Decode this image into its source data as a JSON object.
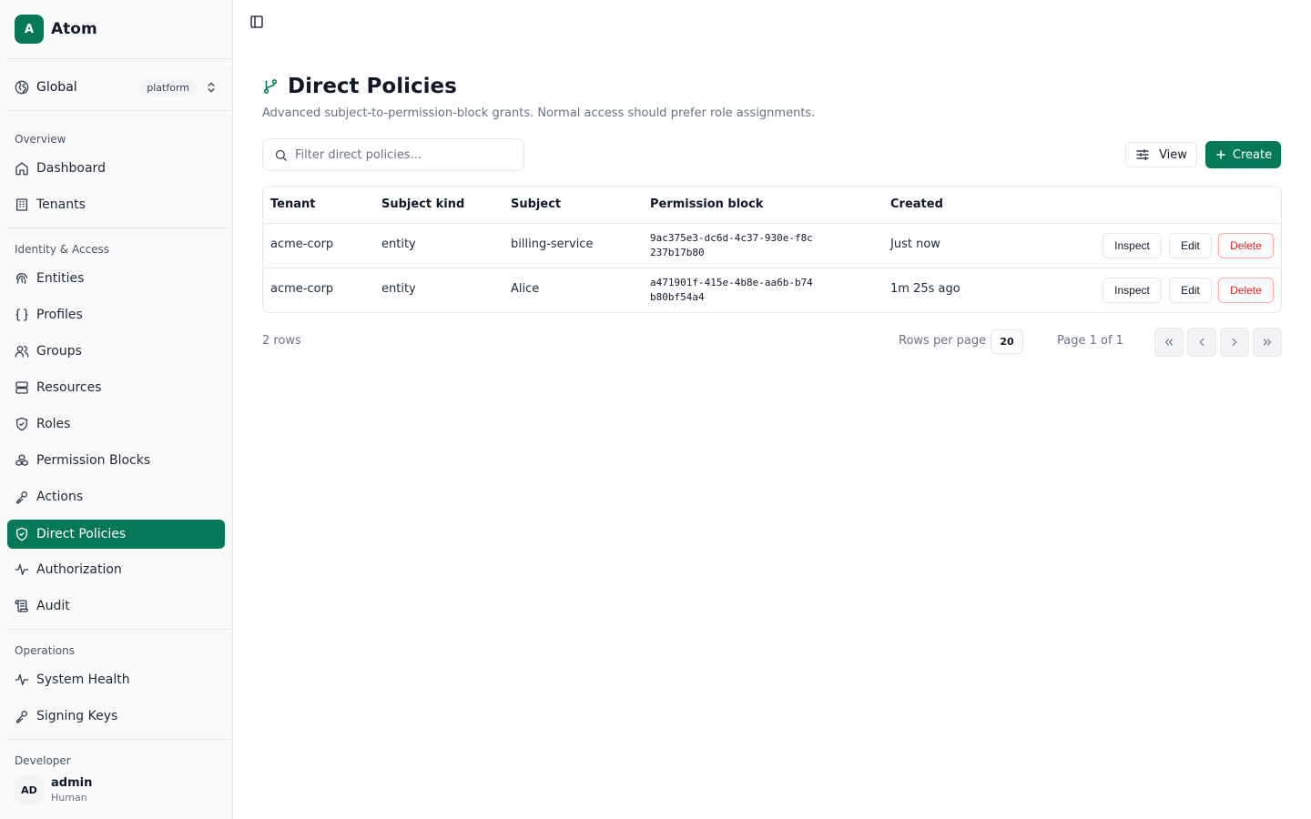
{
  "app": {
    "logo_letter": "A",
    "name": "Atom"
  },
  "scope": {
    "label": "Global",
    "badge": "platform"
  },
  "sidebar": {
    "groups": [
      {
        "label": "Overview",
        "items": [
          {
            "label": "Dashboard",
            "icon": "home-icon"
          },
          {
            "label": "Tenants",
            "icon": "building-icon"
          }
        ]
      },
      {
        "label": "Identity & Access",
        "items": [
          {
            "label": "Entities",
            "icon": "fingerprint-icon"
          },
          {
            "label": "Profiles",
            "icon": "braces-icon"
          },
          {
            "label": "Groups",
            "icon": "users-icon"
          },
          {
            "label": "Resources",
            "icon": "server-icon"
          },
          {
            "label": "Roles",
            "icon": "shield-check-icon"
          },
          {
            "label": "Permission Blocks",
            "icon": "boxes-icon"
          },
          {
            "label": "Actions",
            "icon": "key-icon"
          },
          {
            "label": "Direct Policies",
            "icon": "shield-check-icon",
            "active": true
          },
          {
            "label": "Authorization",
            "icon": "activity-icon"
          },
          {
            "label": "Audit",
            "icon": "scroll-icon"
          }
        ]
      },
      {
        "label": "Operations",
        "items": [
          {
            "label": "System Health",
            "icon": "activity-icon"
          },
          {
            "label": "Signing Keys",
            "icon": "key-icon"
          }
        ]
      },
      {
        "label": "Developer",
        "items": []
      }
    ]
  },
  "user": {
    "initials": "AD",
    "name": "admin",
    "kind": "Human"
  },
  "page": {
    "title": "Direct Policies",
    "description": "Advanced subject-to-permission-block grants. Normal access should prefer role assignments."
  },
  "toolbar": {
    "filter_placeholder": "Filter direct policies...",
    "filter_value": "",
    "view_label": "View",
    "create_label": "Create"
  },
  "table": {
    "columns": [
      "Tenant",
      "Subject kind",
      "Subject",
      "Permission block",
      "Created"
    ],
    "rows": [
      {
        "tenant": "acme-corp",
        "subject_kind": "entity",
        "subject": "billing-service",
        "permission_block": "9ac375e3-dc6d-4c37-930e-f8c237b17b80",
        "created": "Just now"
      },
      {
        "tenant": "acme-corp",
        "subject_kind": "entity",
        "subject": "Alice",
        "permission_block": "a471901f-415e-4b8e-aa6b-b74b80bf54a4",
        "created": "1m 25s ago"
      }
    ],
    "actions": {
      "inspect": "Inspect",
      "edit": "Edit",
      "delete": "Delete"
    }
  },
  "pagination": {
    "rows_count": "2 rows",
    "rows_per_page_label": "Rows per page",
    "rows_per_page": "20",
    "page_of": "Page 1 of 1"
  },
  "colors": {
    "accent": "#047857",
    "danger": "#dc2626",
    "muted": "#6b7280",
    "border": "#e5e7eb"
  }
}
